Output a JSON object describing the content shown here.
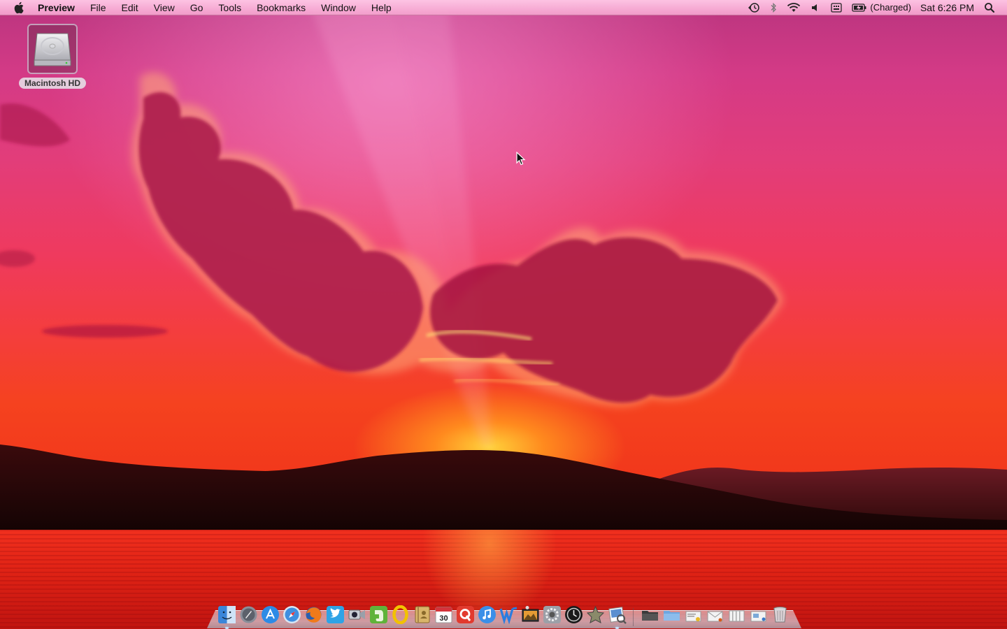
{
  "menubar": {
    "app_name": "Preview",
    "menus": [
      "File",
      "Edit",
      "View",
      "Go",
      "Tools",
      "Bookmarks",
      "Window",
      "Help"
    ],
    "status": {
      "battery_text": "(Charged)",
      "clock": "Sat 6:26 PM"
    }
  },
  "desktop": {
    "icons": [
      {
        "label": "Macintosh HD",
        "icon": "hard-drive-icon"
      }
    ]
  },
  "dock": {
    "apps": [
      {
        "icon": "finder-icon",
        "running": true
      },
      {
        "icon": "launchpad-icon",
        "running": false
      },
      {
        "icon": "app-store-icon",
        "running": false
      },
      {
        "icon": "safari-icon",
        "running": false
      },
      {
        "icon": "firefox-icon",
        "running": false
      },
      {
        "icon": "twitter-icon",
        "running": false
      },
      {
        "icon": "facetime-icon",
        "running": false
      },
      {
        "icon": "evernote-icon",
        "running": false
      },
      {
        "icon": "opera-icon",
        "running": false
      },
      {
        "icon": "address-book-icon",
        "running": false
      },
      {
        "icon": "ical-icon",
        "running": false,
        "badge_text": "30"
      },
      {
        "icon": "quicktime-icon",
        "running": false
      },
      {
        "icon": "itunes-icon",
        "running": false
      },
      {
        "icon": "word-icon",
        "running": false
      },
      {
        "icon": "iphoto-icon",
        "running": false
      },
      {
        "icon": "system-preferences-icon",
        "running": false
      },
      {
        "icon": "time-machine-icon",
        "running": false
      },
      {
        "icon": "utility-icon",
        "running": false
      },
      {
        "icon": "preview-icon",
        "running": true
      }
    ],
    "folders": [
      {
        "icon": "folder-icon"
      },
      {
        "icon": "documents-stack-icon"
      },
      {
        "icon": "downloads-stack-icon"
      },
      {
        "icon": "mail-stack-icon"
      },
      {
        "icon": "applications-stack-icon"
      },
      {
        "icon": "pictures-stack-icon"
      },
      {
        "icon": "trash-icon"
      }
    ]
  },
  "colors": {
    "menubar": "#f6b3d6",
    "sky_top": "#b9357f",
    "sky_mid": "#ef3a5e",
    "horizon": "#f5421f",
    "sun": "#ffd23a",
    "sea": "#e02315",
    "hills": "#2a0808"
  }
}
